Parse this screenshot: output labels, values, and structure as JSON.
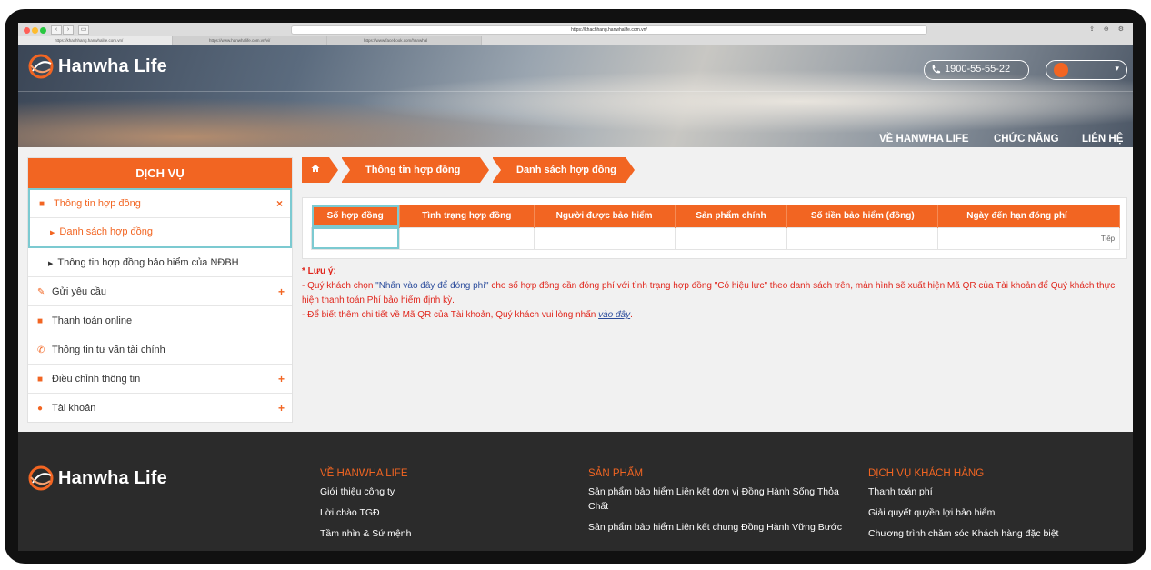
{
  "browser": {
    "url": "https://khachhang.hanwhalife.com.vn/",
    "tabs": [
      "https://khachhang.hanwhalife.com.vn/",
      "https://www.hanwhalife.com.vn/vi/",
      "https://www.facebook.com/hanwhal"
    ]
  },
  "header": {
    "brand": "Hanwha Life",
    "phone": "1900-55-55-22",
    "nav": [
      "VỀ HANWHA LIFE",
      "CHỨC NĂNG",
      "LIÊN HỆ"
    ]
  },
  "sidebar": {
    "title": "DỊCH VỤ",
    "items": [
      {
        "label": "Thông tin hợp đồng",
        "icon": "briefcase-icon",
        "sign": "×"
      },
      {
        "label": "Danh sách hợp đồng"
      },
      {
        "label": "Thông tin hợp đồng bảo hiểm của NĐBH"
      },
      {
        "label": "Gửi yêu cầu",
        "icon": "edit-icon",
        "sign": "+"
      },
      {
        "label": "Thanh toán online",
        "icon": "briefcase-icon"
      },
      {
        "label": "Thông tin tư vấn tài chính",
        "icon": "phone-icon"
      },
      {
        "label": "Điều chỉnh thông tin",
        "icon": "briefcase-icon",
        "sign": "+"
      },
      {
        "label": "Tài khoản",
        "icon": "user-icon",
        "sign": "+"
      }
    ]
  },
  "breadcrumb": {
    "home_icon": "home-icon",
    "items": [
      "Thông tin hợp đồng",
      "Danh sách hợp đồng"
    ]
  },
  "table": {
    "columns": [
      "Số hợp đồng",
      "Tình trạng hợp đồng",
      "Người được bảo hiểm",
      "Sản phẩm chính",
      "Số tiền bảo hiểm (đồng)",
      "Ngày đến hạn đóng phí",
      ""
    ],
    "next_label": "Tiếp"
  },
  "notes": {
    "title": "* Lưu ý:",
    "line1_prefix": "- Quý khách chọn ",
    "line1_quote": "\"Nhấn vào đây để đóng phí\"",
    "line1_suffix": " cho số hợp đồng cần đóng phí với tình trạng hợp đồng \"Có hiệu lực\" theo danh sách trên, màn hình sẽ xuất hiện Mã QR của Tài khoản để Quý khách thực hiện thanh toán Phí bảo hiểm định kỳ.",
    "line2_prefix": "- Để biết thêm chi tiết về Mã QR của Tài khoản, Quý khách vui lòng nhấn ",
    "line2_link": "vào đây",
    "line2_suffix": "."
  },
  "footer": {
    "brand": "Hanwha Life",
    "columns": [
      {
        "title": "VỀ HANWHA LIFE",
        "items": [
          "Giới thiệu công ty",
          "Lời chào TGĐ",
          "Tầm nhìn & Sứ mệnh"
        ]
      },
      {
        "title": "SẢN PHẨM",
        "items": [
          "Sản phẩm bảo hiểm Liên kết đơn vị Đồng Hành Sống Thỏa Chất",
          "Sản phẩm bảo hiểm Liên kết chung Đồng Hành Vững Bước"
        ]
      },
      {
        "title": "DỊCH VỤ KHÁCH HÀNG",
        "items": [
          "Thanh toán phí",
          "Giải quyết quyền lợi bảo hiểm",
          "Chương trình chăm sóc Khách hàng đặc biệt"
        ]
      }
    ]
  },
  "colors": {
    "brand_orange": "#f26522",
    "highlight": "#7ccad1",
    "footer_bg": "#2b2b2b"
  }
}
